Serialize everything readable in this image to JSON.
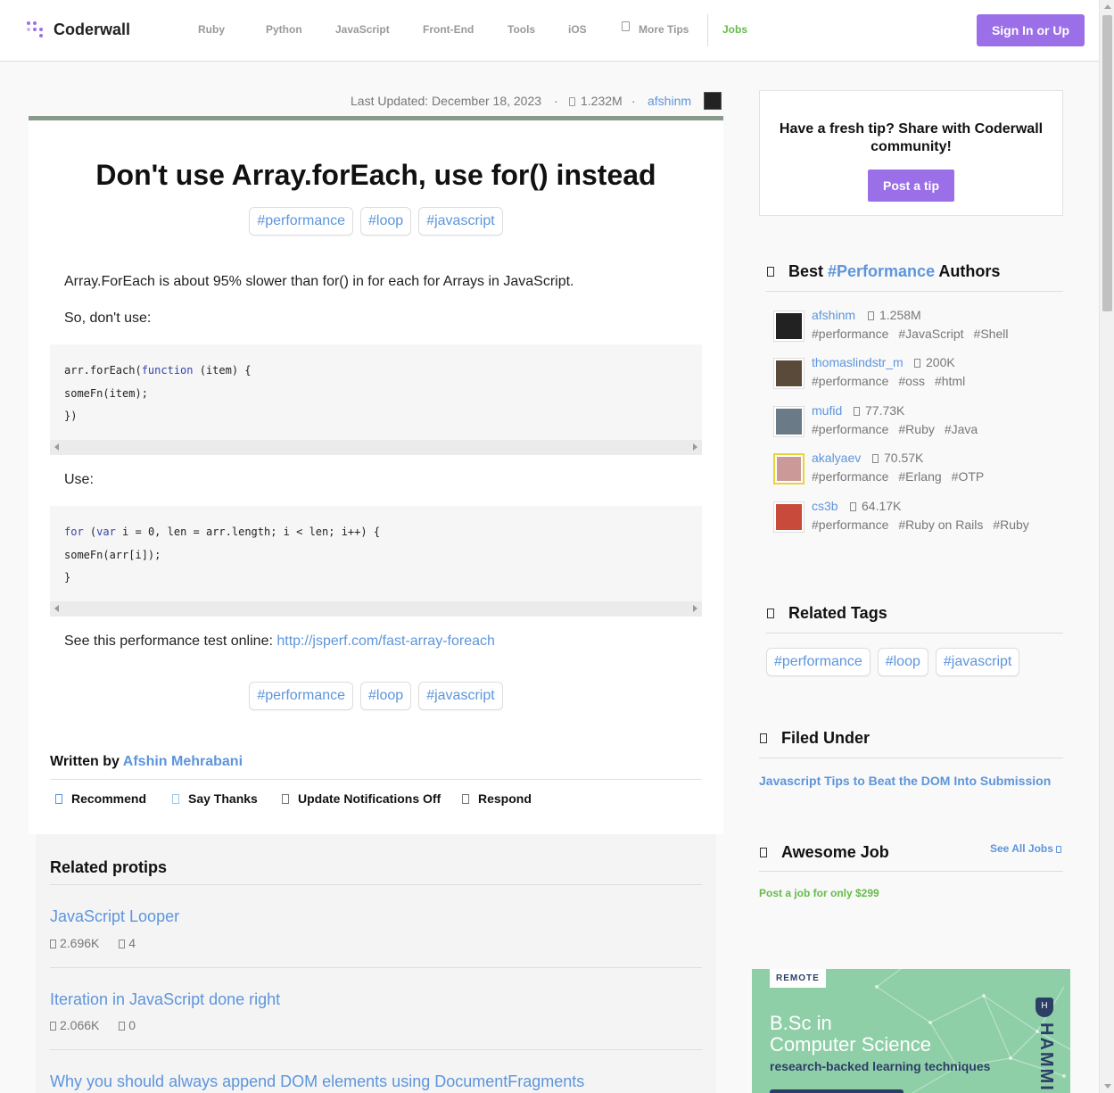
{
  "header": {
    "logo": "Coderwall",
    "nav": [
      "Ruby",
      "Python",
      "JavaScript",
      "Front-End",
      "Tools",
      "iOS",
      "More Tips",
      "Jobs"
    ],
    "signin": "Sign In or Up",
    "colors": {
      "accent": "#9b6fe8",
      "link": "#5d95dc",
      "jobs": "#66bb4a"
    }
  },
  "meta": {
    "last_updated": "Last Updated: December 18, 2023",
    "sep1": "·",
    "views": "1.232M",
    "sep2": "·",
    "author": "afshinm"
  },
  "article": {
    "title": "Don't use Array.forEach, use for() instead",
    "tags": [
      "#performance",
      "#loop",
      "#javascript"
    ],
    "p1": "Array.ForEach is about 95% slower than for() in for each for Arrays in JavaScript.",
    "p2": "So, don't use:",
    "code1": [
      "arr.forEach(",
      "function",
      " (item) {",
      "someFn(item);",
      "})"
    ],
    "p3": "Use:",
    "code2": [
      "for",
      " (",
      "var",
      " i = 0, len = arr.length; i < len; i++) {",
      "someFn(arr[i]);",
      "}"
    ],
    "p4_prefix": "See this performance test online: ",
    "p4_link": "http://jsperf.com/fast-array-foreach",
    "written_prefix": "Written by ",
    "written_author": "Afshin Mehrabani",
    "actions": [
      "Recommend",
      "Say Thanks",
      "Update Notifications Off",
      "Respond"
    ]
  },
  "related": {
    "heading": "Related protips",
    "items": [
      {
        "title": "JavaScript Looper",
        "views": "2.696K",
        "comments": "4"
      },
      {
        "title": "Iteration in JavaScript done right",
        "views": "2.066K",
        "comments": "0"
      },
      {
        "title": "Why you should always append DOM elements using DocumentFragments"
      }
    ]
  },
  "sidebar": {
    "share_text": "Have a fresh tip? Share with Coderwall community!",
    "post_tip": "Post a tip",
    "best_prefix": "Best ",
    "best_tag": "#Performance",
    "best_suffix": " Authors",
    "authors": [
      {
        "name": "afshinm",
        "views": "1.258M",
        "tags": [
          "#performance",
          "#JavaScript",
          "#Shell"
        ]
      },
      {
        "name": "thomaslindstr_m",
        "views": "200K",
        "tags": [
          "#performance",
          "#oss",
          "#html"
        ]
      },
      {
        "name": "mufid",
        "views": "77.73K",
        "tags": [
          "#performance",
          "#Ruby",
          "#Java"
        ]
      },
      {
        "name": "akalyaev",
        "views": "70.57K",
        "tags": [
          "#performance",
          "#Erlang",
          "#OTP"
        ]
      },
      {
        "name": "cs3b",
        "views": "64.17K",
        "tags": [
          "#performance",
          "#Ruby on Rails",
          "#Ruby"
        ]
      }
    ],
    "related_tags_heading": "Related Tags",
    "related_tags": [
      "#performance",
      "#loop",
      "#javascript"
    ],
    "filed_heading": "Filed Under",
    "filed_link": "Javascript Tips to Beat the DOM Into Submission",
    "job_heading": "Awesome Job",
    "see_all_jobs": "See All Jobs",
    "post_job": "Post a job for only $299",
    "ad": {
      "badge": "REMOTE",
      "line1": "B.Sc in",
      "line2": "Computer Science",
      "line3": "research-backed learning techniques",
      "brand": "HAMMI",
      "shield": "H"
    }
  }
}
